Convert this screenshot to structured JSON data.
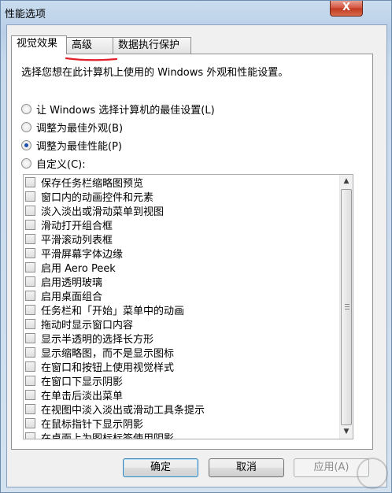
{
  "window": {
    "title": "性能选项",
    "close_glyph": "X"
  },
  "tabs": [
    {
      "label": "视觉效果",
      "active": true
    },
    {
      "label": "高级",
      "active": false
    },
    {
      "label": "数据执行保护",
      "active": false
    }
  ],
  "visual": {
    "intro": "选择您想在此计算机上使用的 Windows 外观和性能设置。",
    "radios": [
      {
        "label": "让 Windows 选择计算机的最佳设置(L)",
        "checked": false
      },
      {
        "label": "调整为最佳外观(B)",
        "checked": false
      },
      {
        "label": "调整为最佳性能(P)",
        "checked": true
      },
      {
        "label": "自定义(C):",
        "checked": false
      }
    ],
    "effects": [
      "保存任务栏缩略图预览",
      "窗口内的动画控件和元素",
      "淡入淡出或滑动菜单到视图",
      "滑动打开组合框",
      "平滑滚动列表框",
      "平滑屏幕字体边缘",
      "启用 Aero Peek",
      "启用透明玻璃",
      "启用桌面组合",
      "任务栏和「开始」菜单中的动画",
      "拖动时显示窗口内容",
      "显示半透明的选择长方形",
      "显示缩略图，而不是显示图标",
      "在窗口和按钮上使用视觉样式",
      "在窗口下显示阴影",
      "在单击后淡出菜单",
      "在视图中淡入淡出或滑动工具条提示",
      "在鼠标指针下显示阴影",
      "在桌面上为图标标签使用阴影"
    ]
  },
  "buttons": {
    "ok": "确定",
    "cancel": "取消",
    "apply": "应用(A)"
  },
  "colors": {
    "annotation": "#e0202a",
    "radio_dot": "#1a4fae"
  }
}
